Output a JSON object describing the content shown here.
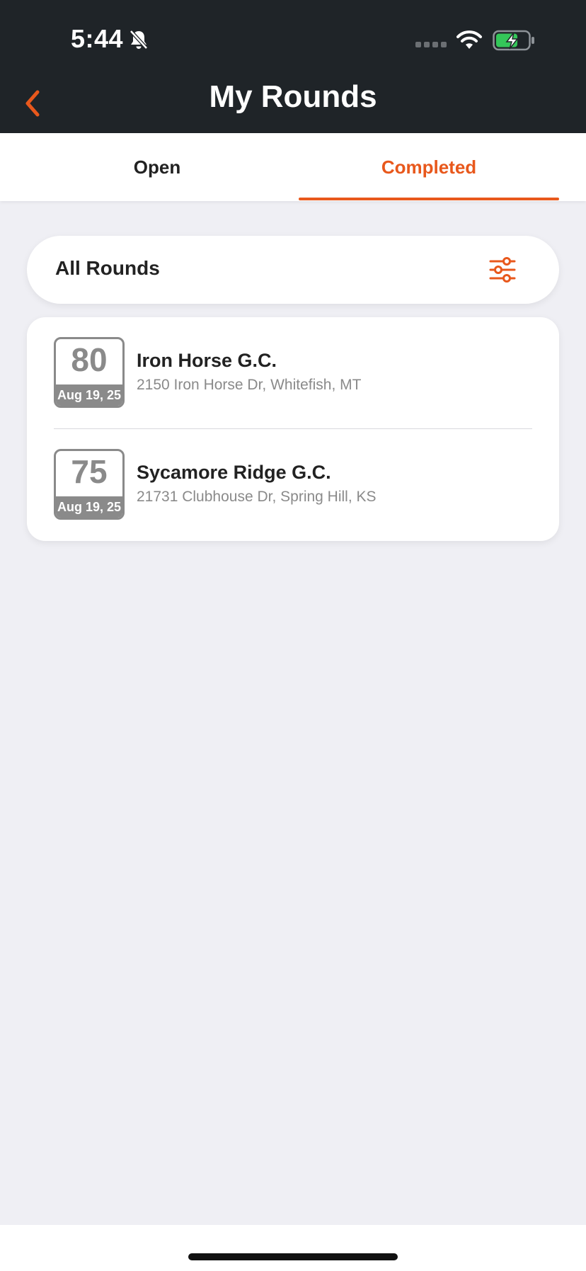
{
  "status_bar": {
    "time": "5:44",
    "icons": [
      "bell-slash-icon",
      "cellular-icon",
      "wifi-icon",
      "battery-charging-icon"
    ]
  },
  "header": {
    "title": "My Rounds",
    "back_icon": "chevron-left-icon"
  },
  "tabs": [
    {
      "label": "Open",
      "selected": false
    },
    {
      "label": "Completed",
      "selected": true
    }
  ],
  "filter": {
    "label": "All Rounds",
    "icon": "sliders-icon"
  },
  "rounds": [
    {
      "score": "80",
      "date": "Aug 19, 25",
      "course": "Iron Horse G.C.",
      "address": "2150 Iron Horse Dr, Whitefish, MT"
    },
    {
      "score": "75",
      "date": "Aug 19, 25",
      "course": "Sycamore Ridge G.C.",
      "address": "21731 Clubhouse Dr, Spring Hill, KS"
    }
  ],
  "colors": {
    "accent": "#e8581c",
    "header_bg": "#1f2428",
    "page_bg": "#efeff4",
    "score_gray": "#8a8a8a",
    "battery_green": "#34c759"
  }
}
